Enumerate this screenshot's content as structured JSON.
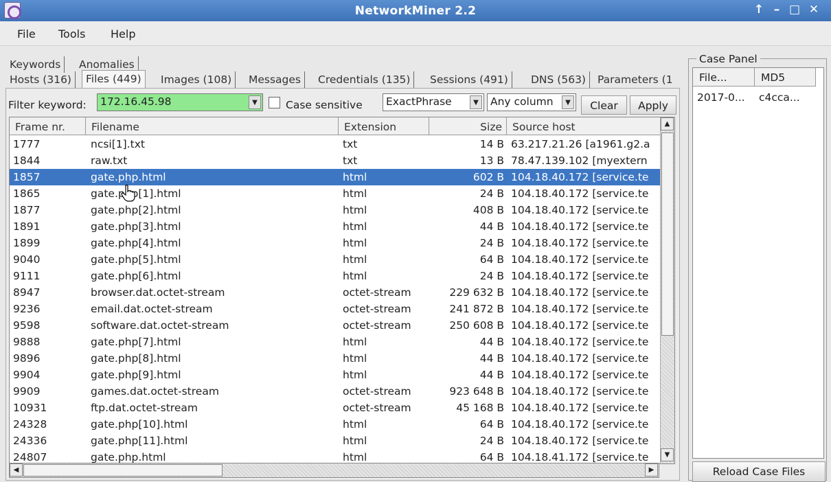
{
  "window": {
    "title": "NetworkMiner 2.2",
    "controls": [
      "↑",
      "–",
      "□",
      "✕"
    ]
  },
  "menu": [
    "File",
    "Tools",
    "Help"
  ],
  "tabs_row1": [
    "Keywords",
    "Anomalies"
  ],
  "tabs_row2": [
    "Hosts (316)",
    "Files (449)",
    "Images (108)",
    "Messages",
    "Credentials (135)",
    "Sessions (491)",
    "DNS (563)",
    "Parameters (1"
  ],
  "filter": {
    "label": "Filter keyword:",
    "value": "172.16.45.98",
    "case_sensitive_label": "Case sensitive",
    "mode": "ExactPhrase",
    "column": "Any column",
    "clear_label": "Clear",
    "apply_label": "Apply",
    "highlight_color": "#90e890"
  },
  "files_table": {
    "columns": [
      "Frame nr.",
      "Filename",
      "Extension",
      "Size",
      "Source host"
    ],
    "selected_row": 2,
    "rows": [
      [
        "1777",
        "ncsi[1].txt",
        "txt",
        "14 B",
        "63.217.21.26 [a1961.g2.a"
      ],
      [
        "1844",
        "raw.txt",
        "txt",
        "13 B",
        "78.47.139.102 [myextern"
      ],
      [
        "1857",
        "gate.php.html",
        "html",
        "602 B",
        "104.18.40.172 [service.te"
      ],
      [
        "1865",
        "gate.php[1].html",
        "html",
        "24 B",
        "104.18.40.172 [service.te"
      ],
      [
        "1877",
        "gate.php[2].html",
        "html",
        "408 B",
        "104.18.40.172 [service.te"
      ],
      [
        "1891",
        "gate.php[3].html",
        "html",
        "44 B",
        "104.18.40.172 [service.te"
      ],
      [
        "1899",
        "gate.php[4].html",
        "html",
        "24 B",
        "104.18.40.172 [service.te"
      ],
      [
        "9040",
        "gate.php[5].html",
        "html",
        "64 B",
        "104.18.40.172 [service.te"
      ],
      [
        "9111",
        "gate.php[6].html",
        "html",
        "24 B",
        "104.18.40.172 [service.te"
      ],
      [
        "8947",
        "browser.dat.octet-stream",
        "octet-stream",
        "229 632 B",
        "104.18.40.172 [service.te"
      ],
      [
        "9236",
        "email.dat.octet-stream",
        "octet-stream",
        "241 872 B",
        "104.18.40.172 [service.te"
      ],
      [
        "9598",
        "software.dat.octet-stream",
        "octet-stream",
        "250 608 B",
        "104.18.40.172 [service.te"
      ],
      [
        "9888",
        "gate.php[7].html",
        "html",
        "44 B",
        "104.18.40.172 [service.te"
      ],
      [
        "9896",
        "gate.php[8].html",
        "html",
        "44 B",
        "104.18.40.172 [service.te"
      ],
      [
        "9904",
        "gate.php[9].html",
        "html",
        "44 B",
        "104.18.40.172 [service.te"
      ],
      [
        "9909",
        "games.dat.octet-stream",
        "octet-stream",
        "923 648 B",
        "104.18.40.172 [service.te"
      ],
      [
        "10931",
        "ftp.dat.octet-stream",
        "octet-stream",
        "45 168 B",
        "104.18.40.172 [service.te"
      ],
      [
        "24328",
        "gate.php[10].html",
        "html",
        "64 B",
        "104.18.40.172 [service.te"
      ],
      [
        "24336",
        "gate.php[11].html",
        "html",
        "24 B",
        "104.18.40.172 [service.te"
      ],
      [
        "24807",
        "gate.php.html",
        "html",
        "64 B",
        "104.18.41.172 [service.te"
      ]
    ]
  },
  "case_panel": {
    "title": "Case Panel",
    "columns": [
      "File...",
      "MD5"
    ],
    "row": [
      "2017-0...",
      "c4cca..."
    ],
    "reload_label": "Reload Case Files"
  }
}
